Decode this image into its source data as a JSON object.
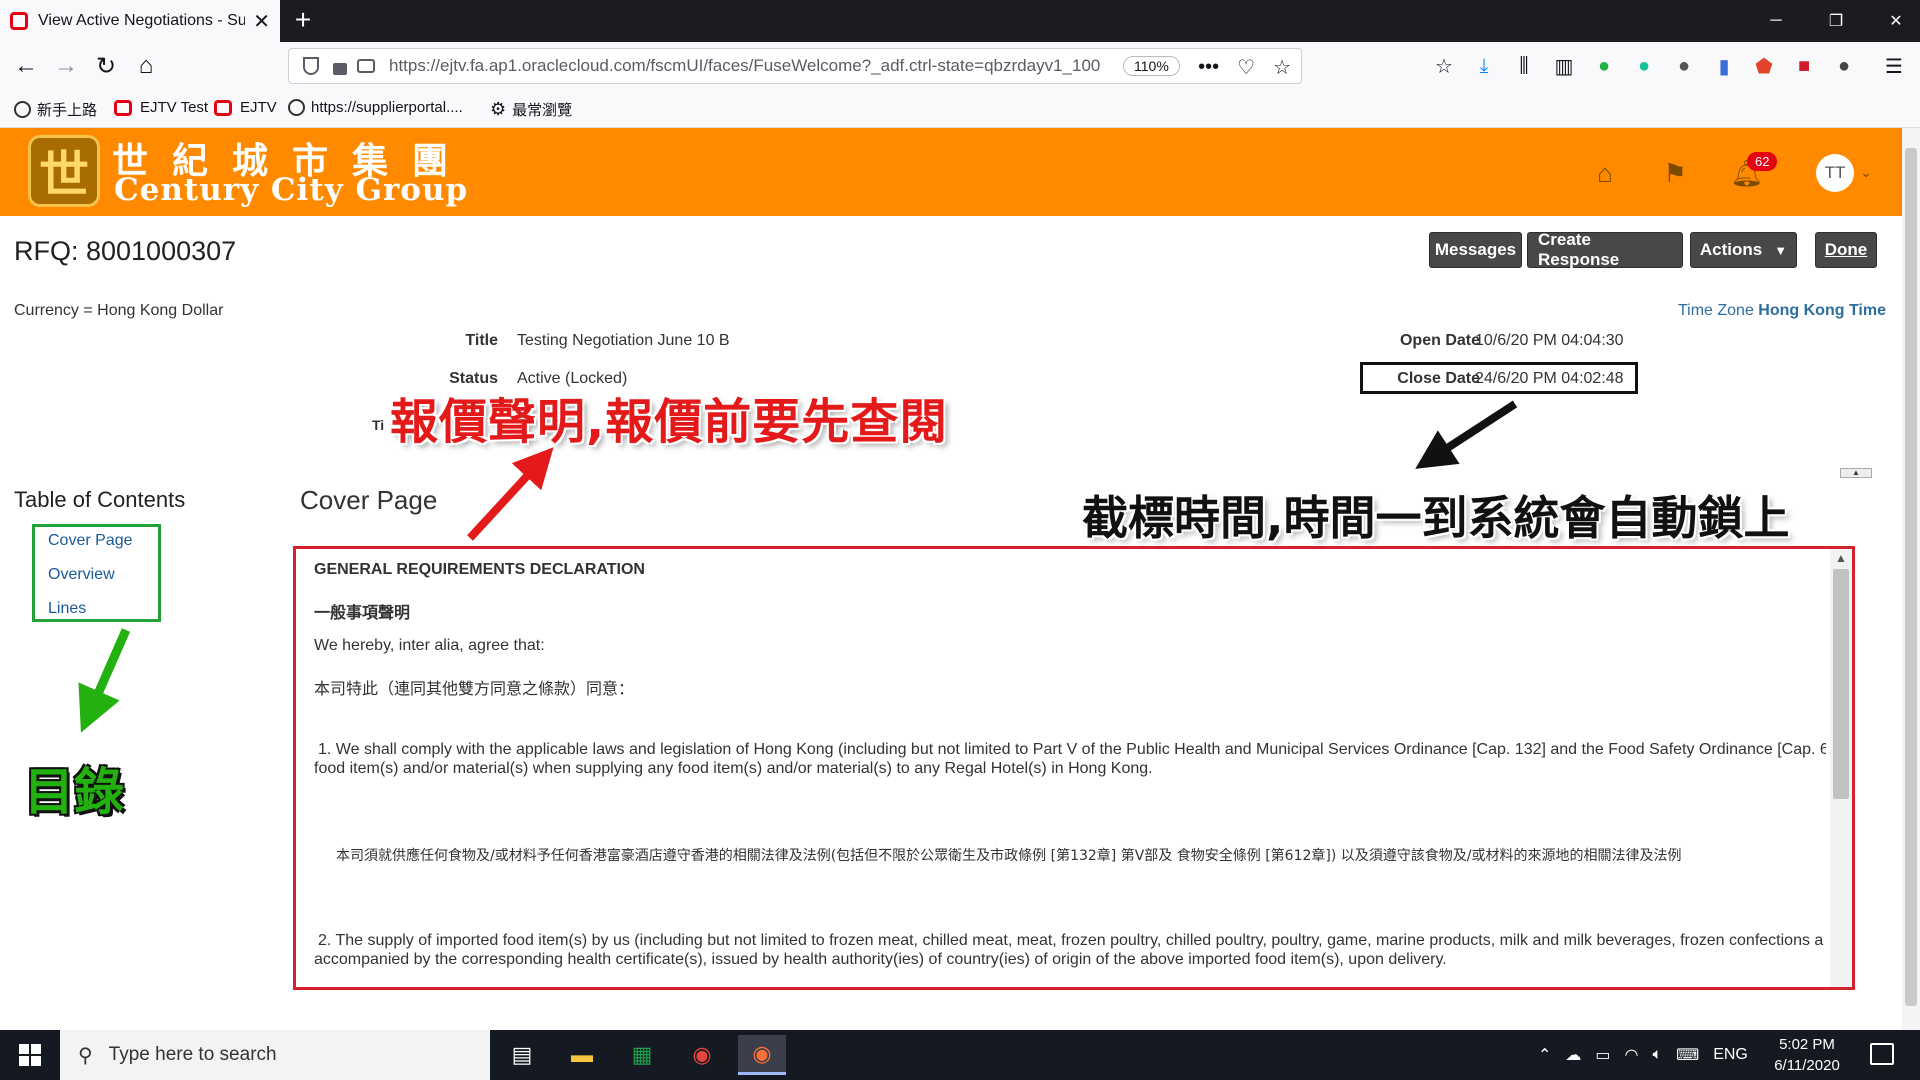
{
  "browser": {
    "tab_title": "View Active Negotiations - Sup",
    "url": "https://ejtv.fa.ap1.oraclecloud.com/fscmUI/faces/FuseWelcome?_adf.ctrl-state=qbzrdayv1_100",
    "zoom": "110%",
    "bookmarks": [
      "新手上路",
      "EJTV Test",
      "EJTV",
      "https://supplierportal....",
      "最常瀏覽"
    ]
  },
  "header": {
    "logo_zh": "世紀城市集團",
    "logo_en": "Century City Group",
    "notification_count": "62",
    "avatar_initials": "TT"
  },
  "rfq": {
    "title": "RFQ: 8001000307",
    "buttons": {
      "messages": "Messages",
      "create_response": "Create Response",
      "actions": "Actions",
      "done": "Done"
    },
    "currency": "Currency = Hong Kong Dollar",
    "timezone_label": "Time Zone",
    "timezone_value": "Hong Kong Time",
    "fields": {
      "title_label": "Title",
      "title_value": "Testing Negotiation June 10 B",
      "status_label": "Status",
      "status_value": "Active (Locked)",
      "partial_label": "Ti",
      "open_label": "Open Date",
      "open_value": "10/6/20 PM 04:04:30",
      "close_label": "Close Date",
      "close_value": "24/6/20 PM 04:02:48"
    }
  },
  "annotations": {
    "red": "報價聲明,報價前要先查閱",
    "black": "截標時間,時間一到系統會自動鎖上",
    "green": "目錄"
  },
  "toc": {
    "title": "Table of Contents",
    "items": [
      "Cover Page",
      "Overview",
      "Lines"
    ]
  },
  "cover": {
    "title": "Cover Page",
    "lines": [
      "GENERAL REQUIREMENTS DECLARATION",
      "一般事項聲明",
      "We hereby, inter alia, agree that:",
      "本司特此（連同其他雙方同意之條款）同意：",
      "1. We shall comply with the applicable laws and legislation of Hong Kong (including but not limited to Part V of the Public Health and Municipal Services Ordinance [Cap. 132] and the Food Safety Ordinance [Cap. 6",
      "food item(s) and/or material(s) when supplying any food item(s) and/or material(s) to any Regal Hotel(s) in Hong Kong.",
      "本司須就供應任何食物及/或材料予任何香港富豪酒店遵守香港的相關法律及法例(包括但不限於公眾衛生及市政條例 [第132章] 第V部及 食物安全條例 [第612章]) 以及須遵守該食物及/或材料的來源地的相關法律及法例",
      "2. The supply of imported food item(s) by us (including but not limited to frozen meat, chilled meat, meat, frozen poultry, chilled poultry, poultry, game, marine products, milk and milk beverages, frozen confections a",
      "accompanied by the corresponding health certificate(s), issued by health authority(ies) of country(ies) of origin of the above imported food item(s), upon delivery."
    ]
  },
  "taskbar": {
    "search_placeholder": "Type here to search",
    "language": "ENG",
    "time": "5:02 PM",
    "date": "6/11/2020"
  }
}
